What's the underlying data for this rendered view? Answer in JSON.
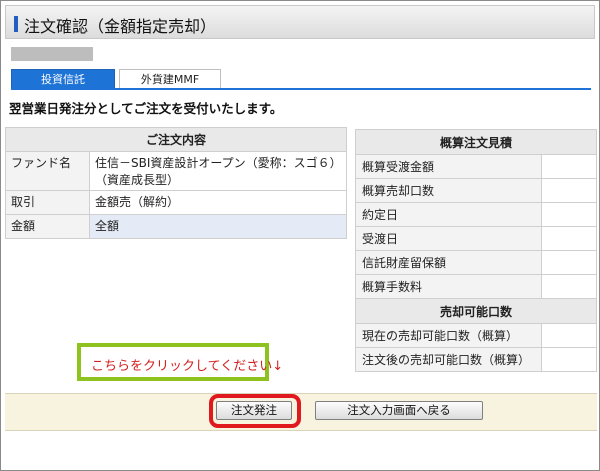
{
  "header": {
    "title": "注文確認（金額指定売却）"
  },
  "tabs": [
    {
      "label": "投資信託",
      "active": true
    },
    {
      "label": "外貨建MMF",
      "active": false
    }
  ],
  "message": "翌営業日発注分としてご注文を受付いたします。",
  "order_details": {
    "heading": "ご注文内容",
    "rows": [
      {
        "label": "ファンド名",
        "value_line1": "住信－SBI資産設計オープン（愛称：スゴ６）",
        "value_line2": "（資産成長型）"
      },
      {
        "label": "取引",
        "value": "金額売（解約）"
      },
      {
        "label": "金額",
        "value": "全額"
      }
    ]
  },
  "estimate": {
    "heading": "概算注文見積",
    "rows": [
      "概算受渡金額",
      "概算売却口数",
      "約定日",
      "受渡日",
      "信託財産留保額",
      "概算手数料"
    ]
  },
  "sellable": {
    "heading": "売却可能口数",
    "rows": [
      "現在の売却可能口数（概算）",
      "注文後の売却可能口数（概算）"
    ]
  },
  "annotation": {
    "text": "こちらをクリックしてください↓"
  },
  "buttons": {
    "order": "注文発注",
    "back": "注文入力画面へ戻る"
  },
  "colors": {
    "accent_blue": "#1e73d6",
    "annotation_green": "#8dc21f",
    "highlight_red": "#e0191e",
    "annotation_text": "#d42020"
  }
}
